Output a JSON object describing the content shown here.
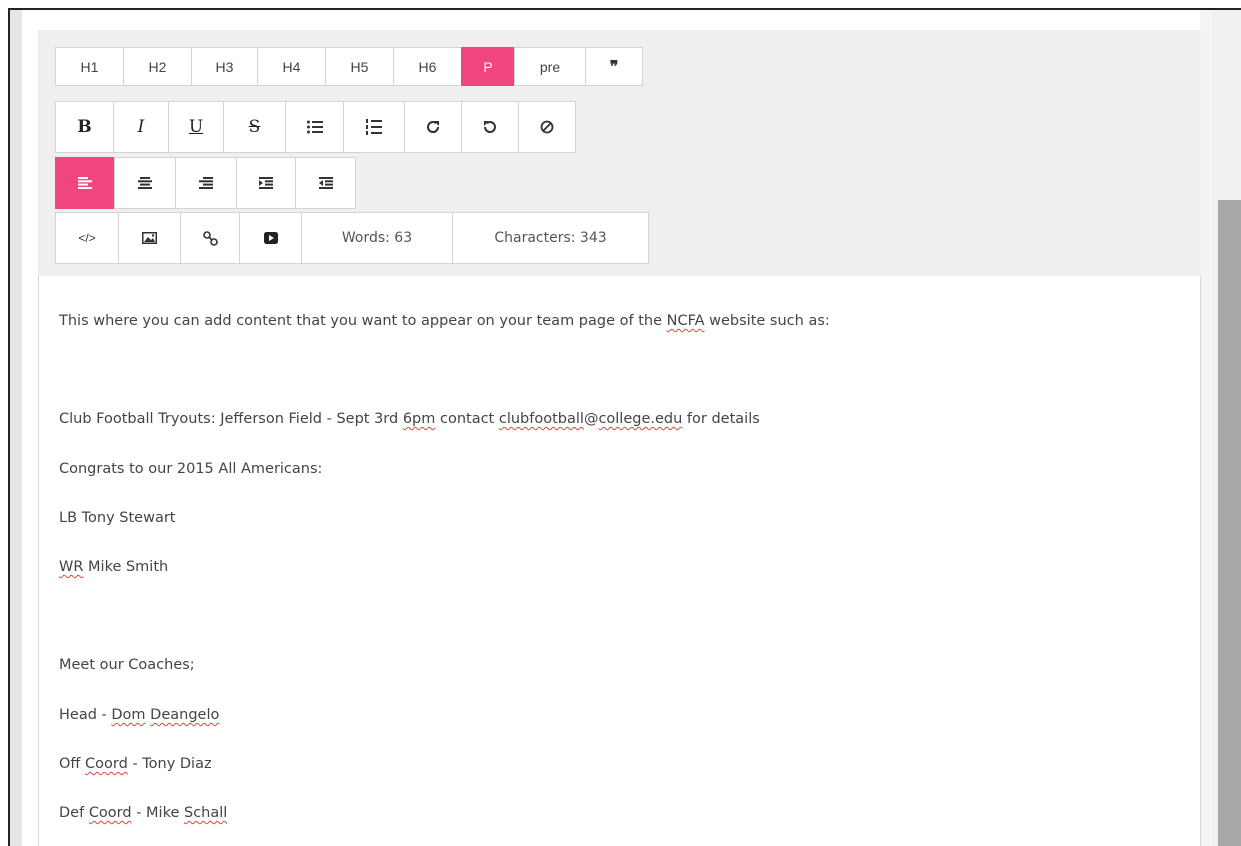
{
  "toolbar": {
    "row1": [
      "H1",
      "H2",
      "H3",
      "H4",
      "H5",
      "H6",
      "P",
      "pre",
      "❞"
    ],
    "row1_active": "P",
    "row2_icons": [
      "bold-icon",
      "italic-icon",
      "underline-icon",
      "strikethrough-icon",
      "bullet-list-icon",
      "numbered-list-icon",
      "redo-icon",
      "undo-icon",
      "clear-format-icon"
    ],
    "row2_text": {
      "bold": "B",
      "italic": "I",
      "underline": "U",
      "strike": "S"
    },
    "row3_icons": [
      "align-left-icon",
      "align-center-icon",
      "align-right-icon",
      "indent-icon",
      "outdent-icon"
    ],
    "row3_active": "align-left-icon",
    "row4_icons": [
      "code-icon",
      "image-icon",
      "link-icon",
      "video-icon"
    ],
    "code_label": "</>",
    "words_label": "Words: 63",
    "characters_label": "Characters: 343"
  },
  "editor": {
    "lines": [
      {
        "segments": [
          {
            "t": "This where you can add content that you want to appear on your team page of the "
          },
          {
            "t": "NCFA",
            "sq": true
          },
          {
            "t": " website such as:"
          }
        ]
      },
      {
        "segments": []
      },
      {
        "segments": [
          {
            "t": "Club Football Tryouts:  Jefferson Field - Sept 3rd "
          },
          {
            "t": "6pm",
            "sq": true
          },
          {
            "t": " contact "
          },
          {
            "t": "clubfootball",
            "sq": true
          },
          {
            "t": "@"
          },
          {
            "t": "college.edu",
            "sq": true
          },
          {
            "t": " for details"
          }
        ]
      },
      {
        "segments": [
          {
            "t": "Congrats to our 2015 All Americans:"
          }
        ]
      },
      {
        "segments": [
          {
            "t": "LB Tony Stewart"
          }
        ]
      },
      {
        "segments": [
          {
            "t": "WR",
            "sq": true
          },
          {
            "t": " Mike Smith"
          }
        ]
      },
      {
        "segments": []
      },
      {
        "segments": [
          {
            "t": "Meet our Coaches;"
          }
        ]
      },
      {
        "segments": [
          {
            "t": "Head - "
          },
          {
            "t": "Dom",
            "sq": true
          },
          {
            "t": " "
          },
          {
            "t": "Deangelo",
            "sq": true
          }
        ]
      },
      {
        "segments": [
          {
            "t": "Off "
          },
          {
            "t": "Coord",
            "sq": true
          },
          {
            "t": " - Tony Diaz"
          }
        ]
      },
      {
        "segments": [
          {
            "t": "Def "
          },
          {
            "t": "Coord",
            "sq": true
          },
          {
            "t": " - Mike "
          },
          {
            "t": "Schall",
            "sq": true
          }
        ]
      }
    ]
  },
  "colors": {
    "accent": "#f0457f",
    "toolbar_bg": "#efefef",
    "scrollbar_thumb": "#a8a8a8"
  }
}
